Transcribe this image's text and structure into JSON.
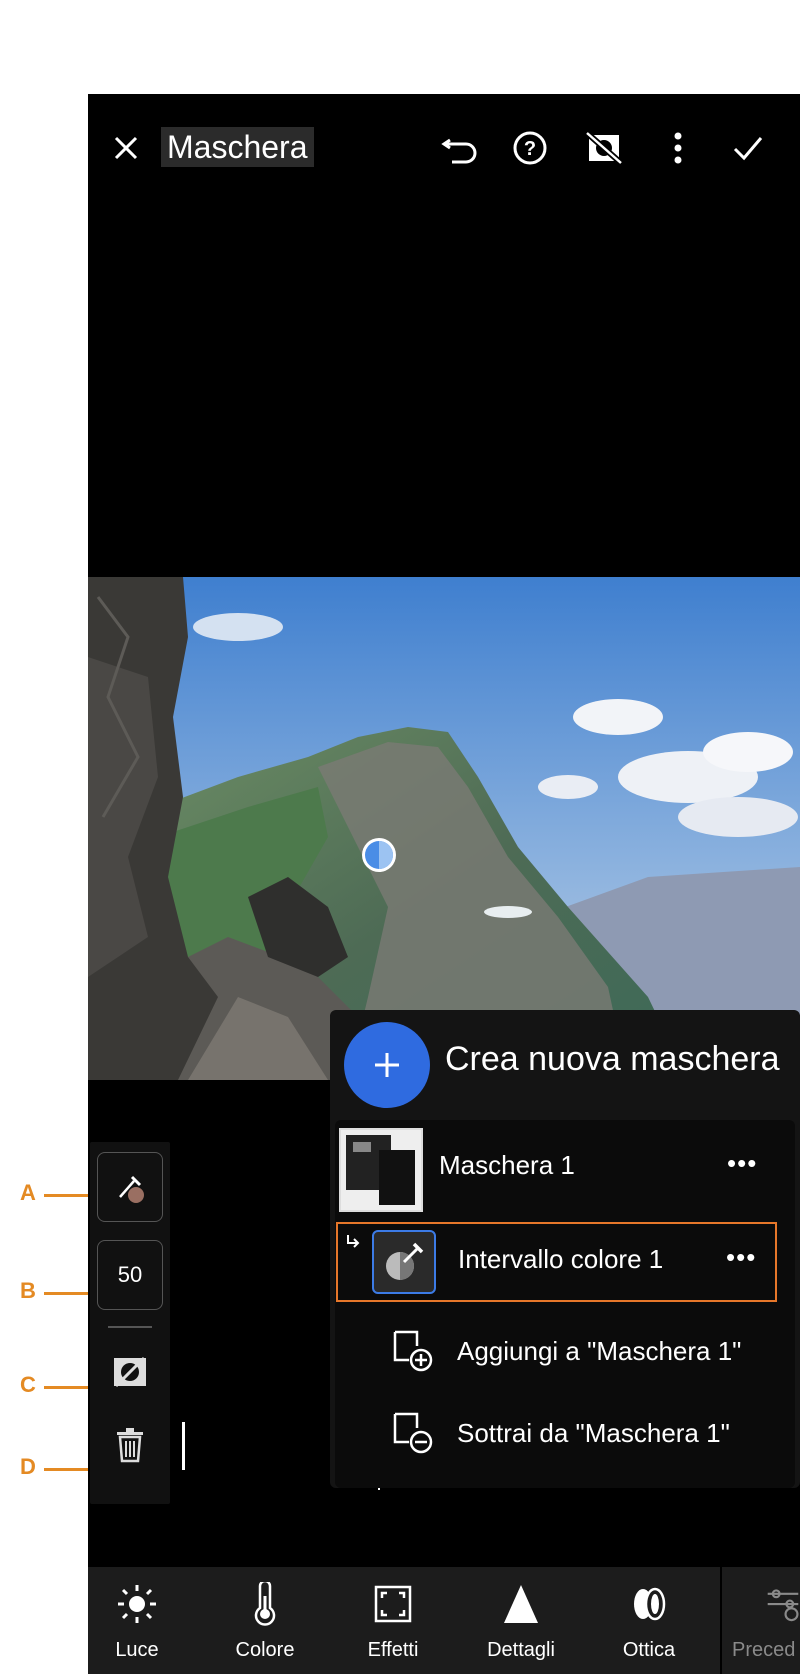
{
  "header": {
    "title": "Maschera",
    "close_icon": "close-icon",
    "undo_icon": "undo-icon",
    "help_icon": "help-icon",
    "overlay_toggle_icon": "mask-overlay-off-icon",
    "more_icon": "more-vertical-icon",
    "confirm_icon": "check-icon"
  },
  "side_tools": {
    "brush_icon": "color-picker-icon",
    "refine_value": "50",
    "invert_icon": "invert-mask-icon",
    "delete_icon": "trash-icon"
  },
  "callouts": [
    "A",
    "B",
    "C",
    "D"
  ],
  "masks_panel": {
    "create_label": "Crea nuova maschera",
    "create_icon": "plus-icon",
    "mask_name": "Maschera 1",
    "component_name": "Intervallo colore 1",
    "add_label": "Aggiungi a \"Maschera 1\"",
    "subtract_label": "Sottrai da \"Maschera 1\"",
    "more_label": "•••"
  },
  "bottom_tools": [
    {
      "label": "Luce",
      "icon": "sun-icon"
    },
    {
      "label": "Colore",
      "icon": "thermometer-icon"
    },
    {
      "label": "Effetti",
      "icon": "vignette-icon"
    },
    {
      "label": "Dettagli",
      "icon": "triangle-icon"
    },
    {
      "label": "Ottica",
      "icon": "lens-icon"
    },
    {
      "label": "Preced",
      "icon": "presets-icon"
    }
  ],
  "colors": {
    "accent": "#2f6be0",
    "highlight_border": "#e7772a",
    "callout": "#e48a23",
    "background": "#000000"
  }
}
